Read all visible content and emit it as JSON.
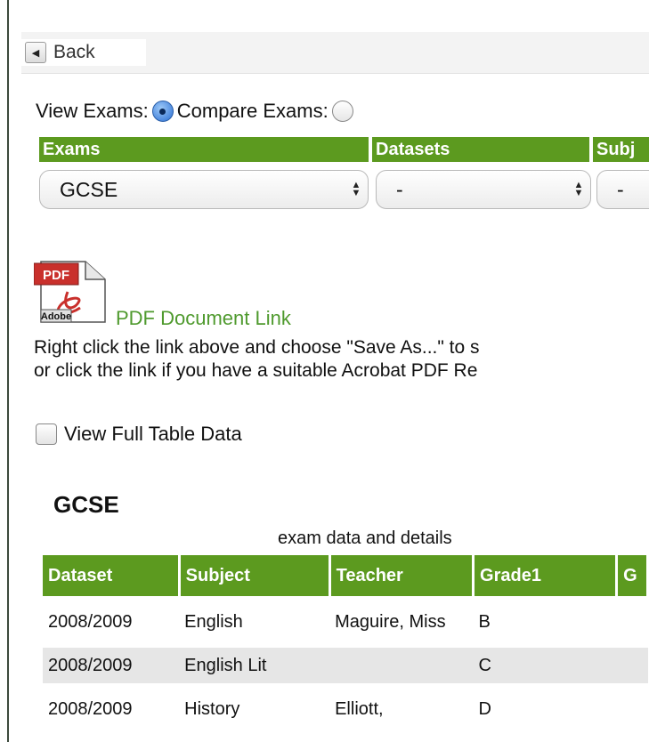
{
  "nav": {
    "back_label": "Back"
  },
  "view_mode": {
    "view_label": "View Exams:",
    "compare_label": "Compare Exams:",
    "selected": "view"
  },
  "filters": [
    {
      "header": "Exams",
      "value": "GCSE"
    },
    {
      "header": "Datasets",
      "value": "-"
    },
    {
      "header": "Subj",
      "value": "-"
    }
  ],
  "pdf": {
    "icon_label": "PDF",
    "icon_brand": "Adobe",
    "link_text": "PDF Document Link",
    "help_line1": "Right click the link above and choose \"Save As...\" to s",
    "help_line2": "or click the link if you have a suitable Acrobat PDF Re"
  },
  "full_table_checkbox": {
    "label": "View Full Table Data",
    "checked": false
  },
  "section": {
    "title": "GCSE",
    "caption": "exam data and details"
  },
  "table": {
    "columns": [
      "Dataset",
      "Subject",
      "Teacher",
      "Grade1",
      "G"
    ],
    "rows": [
      {
        "dataset": "2008/2009",
        "subject": "English",
        "teacher": "Maguire, Miss",
        "grade1": "B"
      },
      {
        "dataset": "2008/2009",
        "subject": "English Lit",
        "teacher": "",
        "grade1": "C"
      },
      {
        "dataset": "2008/2009",
        "subject": "History",
        "teacher": "Elliott,",
        "grade1": "D"
      }
    ]
  },
  "colors": {
    "header_green": "#5c9a1f",
    "link_green": "#4f9a2e",
    "row_alt": "#e6e6e6"
  }
}
